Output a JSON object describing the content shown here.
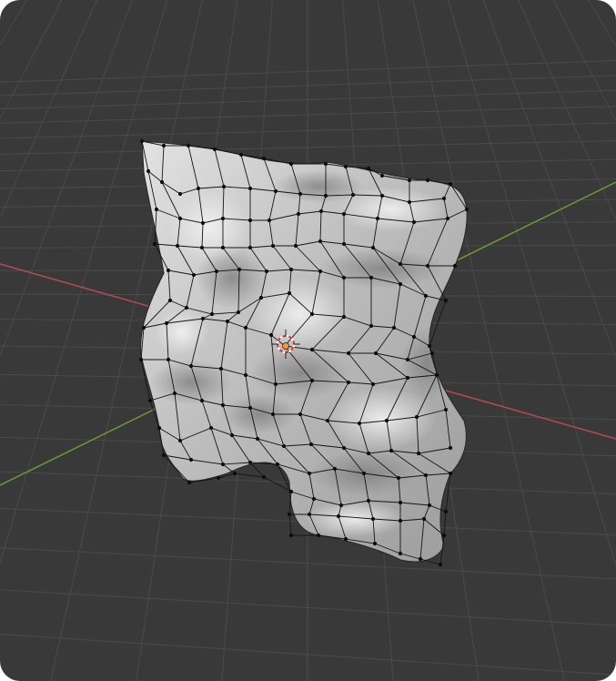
{
  "viewport": {
    "background": "#393939",
    "grid_color": "#4a4a4a",
    "x_axis_color": "#b54a56",
    "y_axis_color": "#6e9a3a",
    "mesh_color": "#c8c8c8",
    "edge_color": "#151515",
    "origin_color": "#ff9a1f"
  },
  "object": {
    "type": "cloth-plane",
    "mode": "edit-mode"
  }
}
